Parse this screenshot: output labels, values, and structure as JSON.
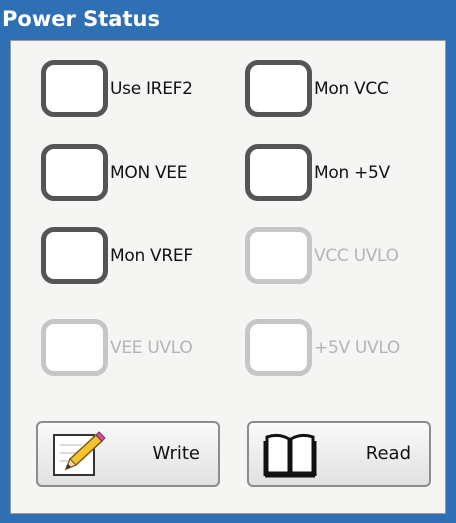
{
  "window": {
    "title": "Power Status"
  },
  "checkboxes": [
    {
      "label": "Use IREF2",
      "enabled": true
    },
    {
      "label": "Mon VCC",
      "enabled": true
    },
    {
      "label": "MON VEE",
      "enabled": true
    },
    {
      "label": "Mon +5V",
      "enabled": true
    },
    {
      "label": "Mon VREF",
      "enabled": true
    },
    {
      "label": "VCC UVLO",
      "enabled": false
    },
    {
      "label": "VEE UVLO",
      "enabled": false
    },
    {
      "label": "+5V UVLO",
      "enabled": false
    }
  ],
  "buttons": {
    "write": {
      "label": "Write",
      "icon": "pencil-paper-icon"
    },
    "read": {
      "label": "Read",
      "icon": "open-book-icon"
    }
  },
  "colors": {
    "title_bar": "#2f6fb4",
    "panel_background": "#f5f5f3",
    "checkbox_border_enabled": "#555555",
    "checkbox_border_disabled": "#c6c6c6",
    "disabled_text": "#b4b4b4"
  }
}
